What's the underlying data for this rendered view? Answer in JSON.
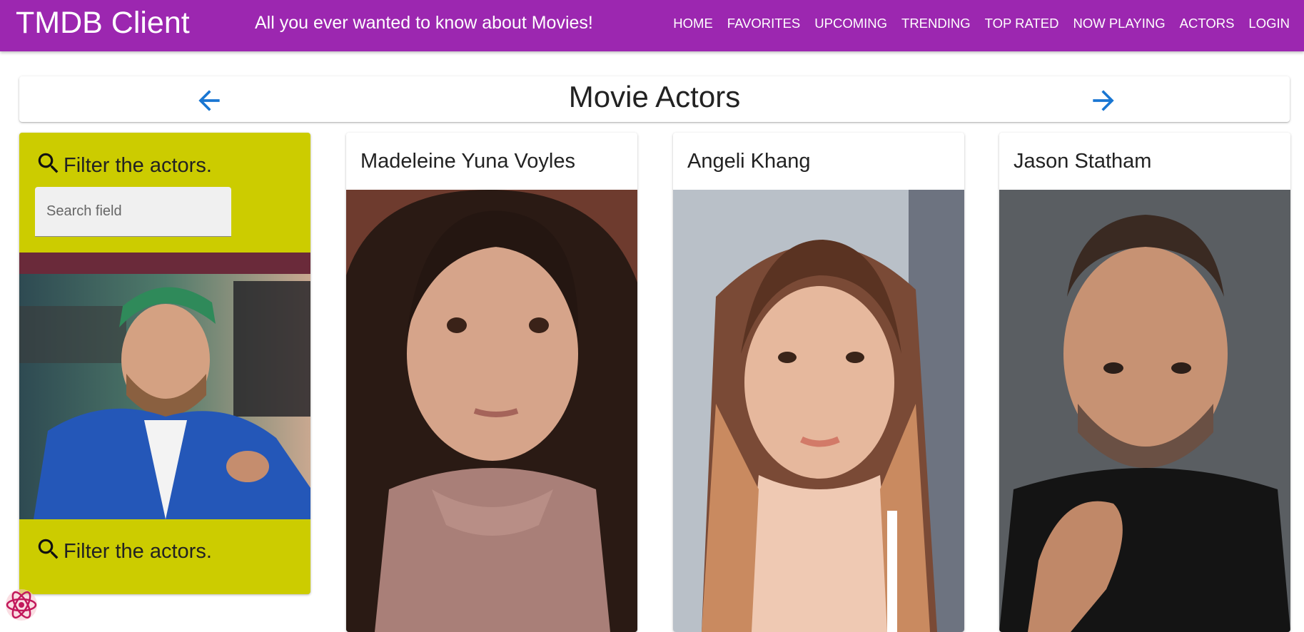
{
  "appbar": {
    "brand": "TMDB Client",
    "tagline": "All you ever wanted to know about Movies!",
    "nav": [
      "Home",
      "Favorites",
      "Upcoming",
      "Trending",
      "Top Rated",
      "Now Playing",
      "Actors",
      "Login"
    ]
  },
  "header": {
    "title": "Movie Actors",
    "prev_icon": "arrow-left-icon",
    "next_icon": "arrow-right-icon"
  },
  "filter": {
    "label_top": "Filter the actors.",
    "label_bottom": "Filter the actors.",
    "search_placeholder": "Search field",
    "search_value": "",
    "icon": "search-icon"
  },
  "actors": [
    {
      "name": "Madeleine Yuna Voyles"
    },
    {
      "name": "Angeli Khang"
    },
    {
      "name": "Jason Statham"
    }
  ],
  "colors": {
    "appbar": "#9c27b0",
    "filter_card": "#cccc00",
    "accent_arrow": "#1976d2"
  }
}
